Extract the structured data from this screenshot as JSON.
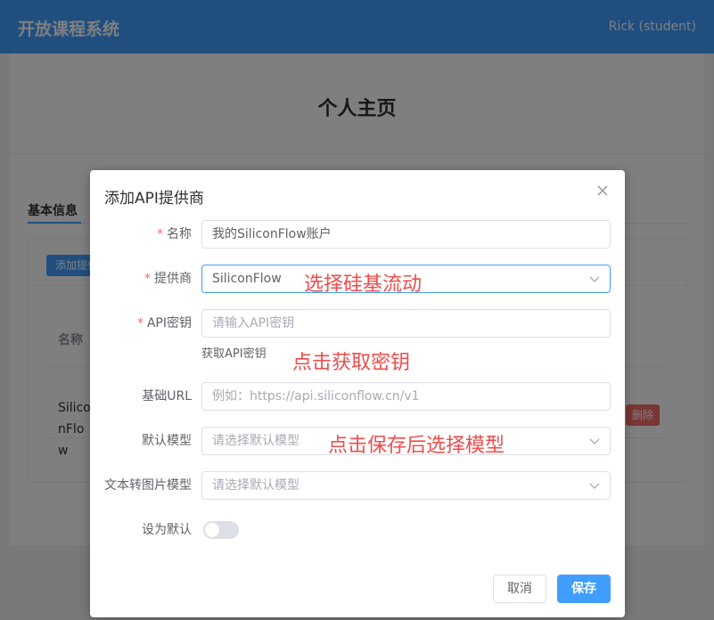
{
  "app": {
    "title": "开放课程系统",
    "user": "Rick (student)"
  },
  "page": {
    "title": "个人主页",
    "tab_basic": "基本信息",
    "add_button": "添加提供商",
    "column_name": "名称",
    "row_name": "SiliconFlow",
    "delete_button": "删除"
  },
  "dialog": {
    "title": "添加API提供商",
    "fields": {
      "name": {
        "label": "名称",
        "value": "我的SiliconFlow账户",
        "required": true
      },
      "provider": {
        "label": "提供商",
        "value": "SiliconFlow",
        "required": true
      },
      "api_key": {
        "label": "API密钥",
        "placeholder": "请输入API密钥",
        "required": true
      },
      "get_key_link": "获取API密钥",
      "base_url": {
        "label": "基础URL",
        "placeholder": "例如：https://api.siliconflow.cn/v1"
      },
      "default_model": {
        "label": "默认模型",
        "placeholder": "请选择默认模型"
      },
      "image_model": {
        "label": "文本转图片模型",
        "placeholder": "请选择默认模型"
      },
      "set_default": {
        "label": "设为默认",
        "on": false
      }
    },
    "cancel_label": "取消",
    "save_label": "保存"
  },
  "annotations": {
    "provider": "选择硅基流动",
    "api_key": "点击获取密钥",
    "model": "点击保存后选择模型",
    "color": "#f24b4b"
  },
  "colors": {
    "primary": "#409eff",
    "danger": "#f56c6c",
    "required": "#f56c6c"
  }
}
